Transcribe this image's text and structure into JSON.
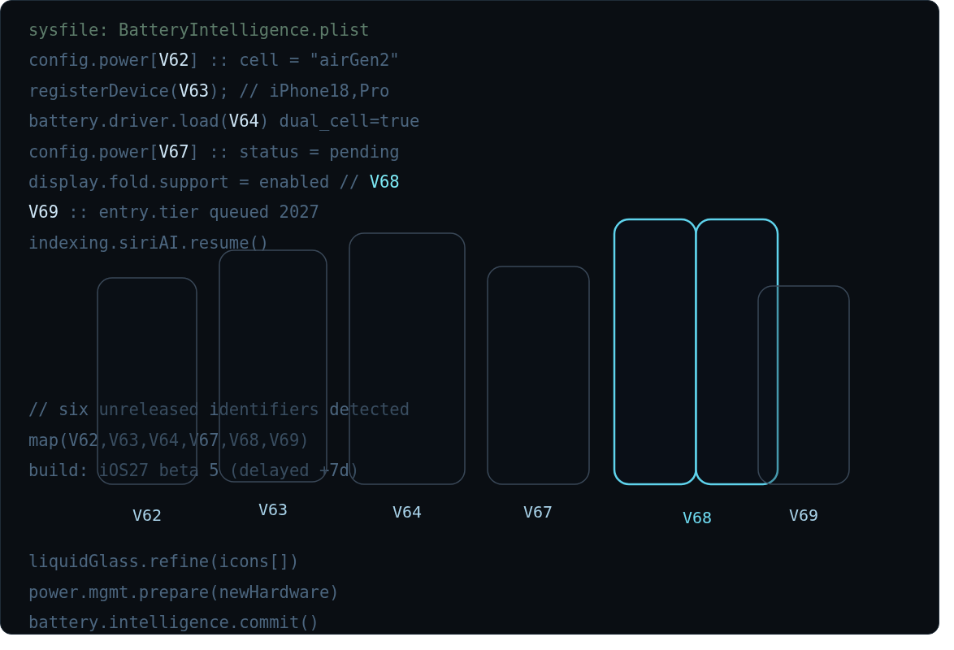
{
  "blocks": [
    {
      "lines": [
        [
          {
            "kind": "file",
            "text": "sysfile: BatteryIntelligence.plist"
          }
        ],
        [
          {
            "kind": "code",
            "text": "config.power["
          },
          {
            "kind": "id",
            "text": "V62"
          },
          {
            "kind": "code",
            "text": "] :: cell = \"airGen2\""
          }
        ],
        [
          {
            "kind": "code",
            "text": "registerDevice("
          },
          {
            "kind": "id",
            "text": "V63"
          },
          {
            "kind": "code",
            "text": "); // iPhone18,Pro"
          }
        ],
        [
          {
            "kind": "code",
            "text": "battery.driver.load("
          },
          {
            "kind": "id",
            "text": "V64"
          },
          {
            "kind": "code",
            "text": ") dual_cell=true"
          }
        ],
        [
          {
            "kind": "code",
            "text": "config.power["
          },
          {
            "kind": "id",
            "text": "V67"
          },
          {
            "kind": "code",
            "text": "] :: status = pending"
          }
        ],
        [
          {
            "kind": "code",
            "text": "display.fold.support = enabled // "
          },
          {
            "kind": "accent",
            "text": "V68"
          }
        ],
        [
          {
            "kind": "id",
            "text": "V69"
          },
          {
            "kind": "code",
            "text": " :: entry.tier queued 2027"
          }
        ],
        [
          {
            "kind": "code",
            "text": "indexing.siriAI.resume()"
          }
        ]
      ]
    },
    {
      "lines": [
        [
          {
            "kind": "code",
            "text": "// six unreleased identifiers detected"
          }
        ],
        [
          {
            "kind": "code",
            "text": "map(V62,V63,V64,V67,V68,V69)"
          }
        ],
        [
          {
            "kind": "code",
            "text": "build: iOS27 beta 5 (delayed +7d)"
          }
        ]
      ]
    },
    {
      "lines": [
        [
          {
            "kind": "code",
            "text": "liquidGlass.refine(icons[])"
          }
        ],
        [
          {
            "kind": "code",
            "text": "power.mgmt.prepare(newHardware)"
          }
        ],
        [
          {
            "kind": "code",
            "text": "battery.intelligence.commit()"
          }
        ]
      ]
    }
  ],
  "devices": [
    {
      "label": "V62",
      "kind": "phone",
      "selected": false
    },
    {
      "label": "V63",
      "kind": "phone",
      "selected": false
    },
    {
      "label": "V64",
      "kind": "phone",
      "selected": false
    },
    {
      "label": "V67",
      "kind": "phone",
      "selected": false
    },
    {
      "label": "V68",
      "kind": "foldable",
      "selected": true
    },
    {
      "label": "V69",
      "kind": "phone",
      "selected": false
    }
  ]
}
